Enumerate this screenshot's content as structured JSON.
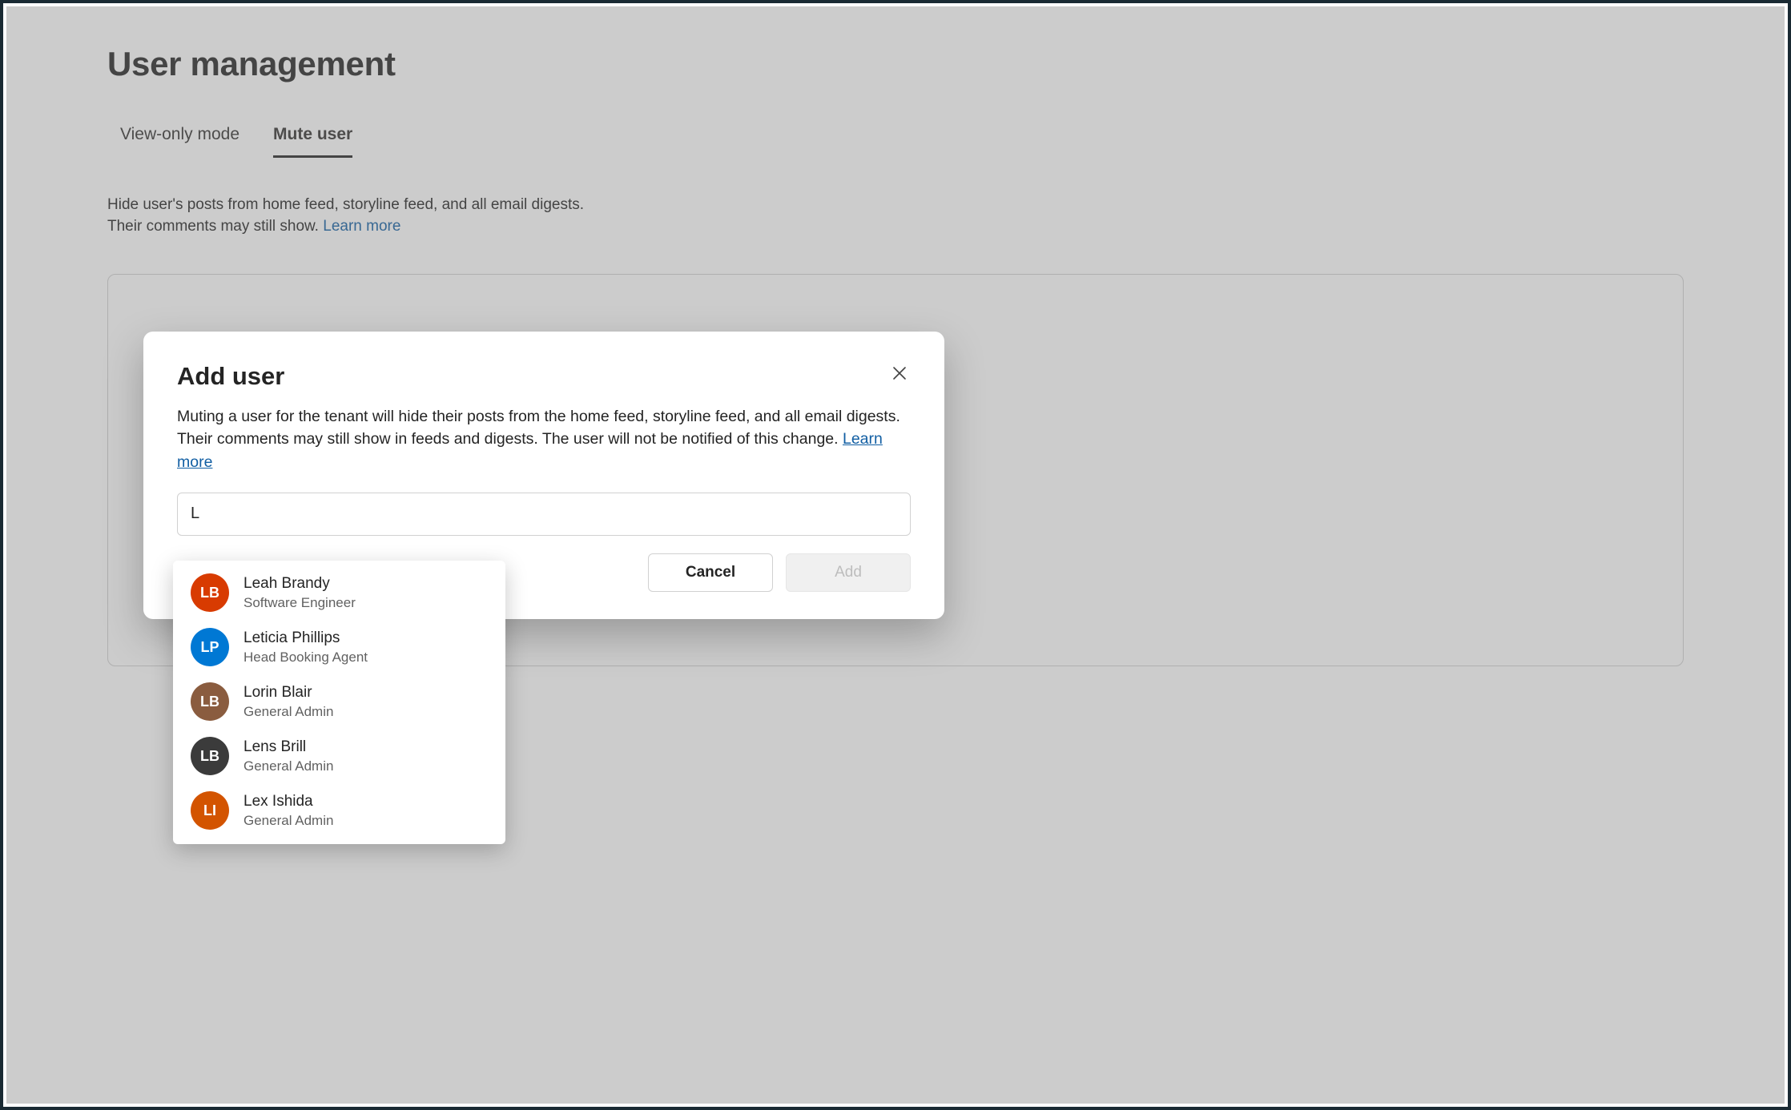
{
  "page": {
    "title": "User management"
  },
  "tabs": {
    "view_only": "View-only mode",
    "mute_user": "Mute user"
  },
  "description": {
    "line1": "Hide user's posts from home feed, storyline feed, and all email digests.",
    "line2_prefix": "Their comments may still show. ",
    "learn_more": "Learn more"
  },
  "dialog": {
    "title": "Add user",
    "body": "Muting a user for the tenant will hide their posts from the home feed, storyline feed, and all email digests. Their comments may still show in feeds and digests. The user will not be notified of this change. ",
    "learn_more": "Learn more",
    "search_value": "L",
    "cancel": "Cancel",
    "add": "Add"
  },
  "suggestions": [
    {
      "name": "Leah Brandy",
      "role": "Software Engineer",
      "avatar_bg": "#d83b01",
      "initials": "LB"
    },
    {
      "name": "Leticia Phillips",
      "role": "Head Booking Agent",
      "avatar_bg": "#0078d4",
      "initials": "LP"
    },
    {
      "name": "Lorin Blair",
      "role": "General Admin",
      "avatar_bg": "#8a5c3f",
      "initials": "LB"
    },
    {
      "name": "Lens Brill",
      "role": "General Admin",
      "avatar_bg": "#3b3b3b",
      "initials": "LB"
    },
    {
      "name": "Lex Ishida",
      "role": "General Admin",
      "avatar_bg": "#d35400",
      "initials": "LI"
    }
  ]
}
